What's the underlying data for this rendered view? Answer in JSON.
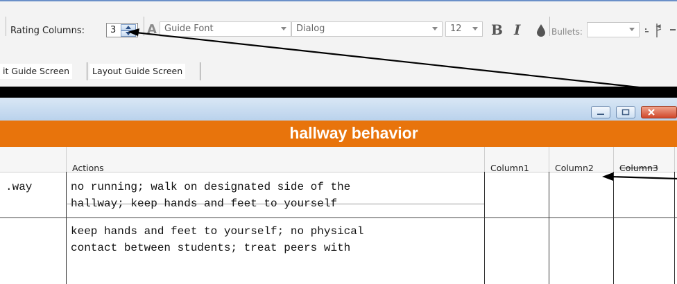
{
  "toolbar": {
    "rating_columns_label": "Rating Columns:",
    "rating_columns_value": "3",
    "font_name_placeholder": "Guide Font",
    "font_family_value": "Dialog",
    "font_size_value": "12",
    "bold_label": "B",
    "italic_label": "I",
    "bullets_label": "Bullets:"
  },
  "tabs": [
    {
      "label": "it Guide Screen"
    },
    {
      "label": "Layout Guide Screen"
    }
  ],
  "window": {
    "title": "hallway behavior"
  },
  "table": {
    "headers": [
      "Actions",
      "Column1",
      "Column2",
      "Column3"
    ],
    "rows": [
      {
        "left_text": ".way",
        "action_lines": [
          "no running; walk on designated side of the",
          "hallway; keep hands and feet to yourself"
        ]
      },
      {
        "left_text": "",
        "action_lines": [
          "keep hands and feet to yourself; no physical",
          "contact between students; treat peers with"
        ]
      }
    ]
  },
  "colors": {
    "header_orange": "#e8740c",
    "titlebar_blue": "#bad2ec",
    "close_red": "#d0472a"
  }
}
